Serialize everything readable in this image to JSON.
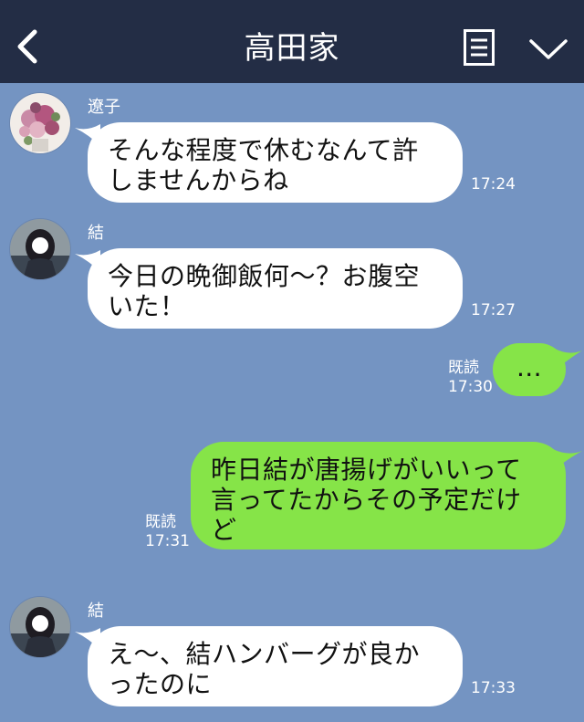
{
  "header": {
    "title": "高田家"
  },
  "messages": [
    {
      "sender": "遼子",
      "text_lines": [
        "そんな程度で休むなんて許",
        "しませんからね"
      ],
      "time": "17:24"
    },
    {
      "sender": "結",
      "text_lines": [
        "今日の晩御飯何〜？お腹空",
        "いた！"
      ],
      "time": "17:27"
    },
    {
      "sender": "me",
      "text_lines": [
        "…"
      ],
      "read": "既読",
      "time": "17:30"
    },
    {
      "sender": "me",
      "text_lines": [
        "昨日結が唐揚げがいいって",
        "言ってたからその予定だけ",
        "ど"
      ],
      "read": "既読",
      "time": "17:31"
    },
    {
      "sender": "結",
      "text_lines": [
        "え〜、結ハンバーグが良か",
        "ったのに"
      ],
      "time": "17:33"
    }
  ],
  "colors": {
    "header_bg": "#232d45",
    "chat_bg": "#7494c2",
    "incoming_bubble": "#ffffff",
    "outgoing_bubble": "#86e448"
  },
  "icons": [
    "back-icon",
    "notes-icon",
    "chevron-down-icon",
    "avatar-flowers",
    "avatar-girl"
  ]
}
